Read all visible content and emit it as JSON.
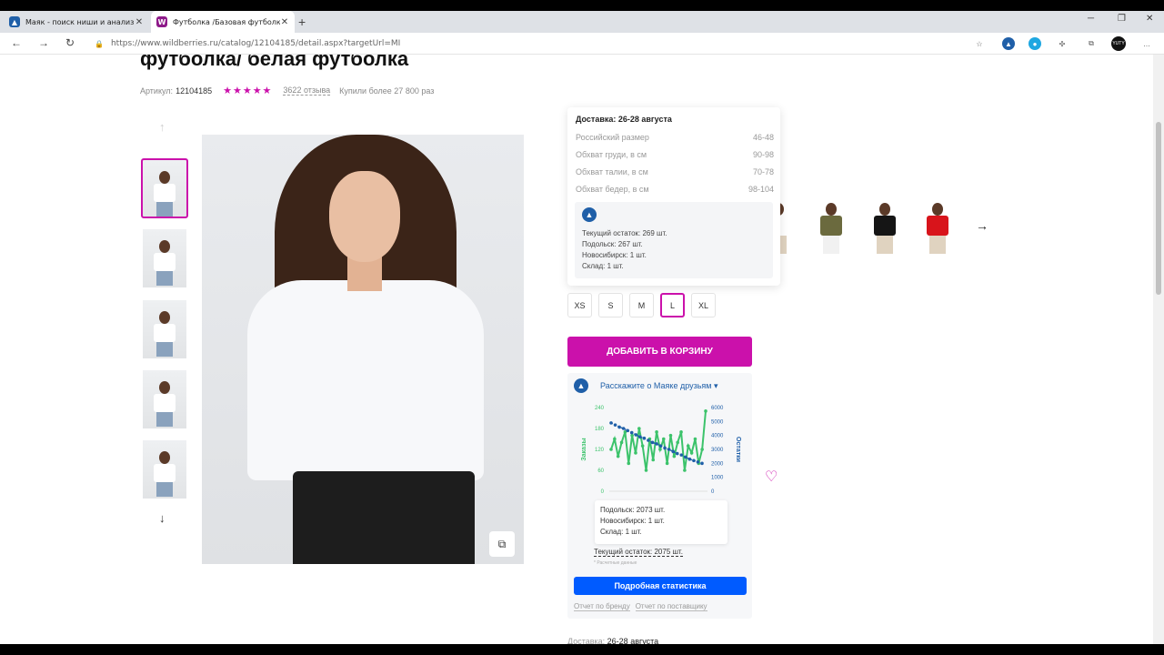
{
  "browser": {
    "tabs": [
      {
        "title": "Маяк - поиск ниши и анализ ко",
        "active": false
      },
      {
        "title": "Футболка /Базовая футболка/ ж",
        "active": true
      }
    ],
    "url": "https://www.wildberries.ru/catalog/12104185/detail.aspx?targetUrl=MI",
    "profile_badge": "YUTY"
  },
  "product": {
    "title": "футболка/ белая футболка",
    "article_label": "Артикул:",
    "article_value": "12104185",
    "stars": "★★★★★",
    "reviews": "3622 отзыва",
    "bought": "Купили более 27 800 раз"
  },
  "size_popup": {
    "delivery": "Доставка: 26-28 августа",
    "rows": [
      {
        "label": "Российский размер",
        "value": "46-48"
      },
      {
        "label": "Обхват груди, в см",
        "value": "90-98"
      },
      {
        "label": "Обхват талии, в см",
        "value": "70-78"
      },
      {
        "label": "Обхват бедер, в см",
        "value": "98-104"
      }
    ],
    "stock_lines": [
      "Текущий остаток: 269 шт.",
      "Подольск: 267 шт.",
      "Новосибирск: 1 шт.",
      "Склад: 1 шт."
    ]
  },
  "sizes": [
    "XS",
    "S",
    "M",
    "L",
    "XL"
  ],
  "selected_size": "L",
  "cart_button": "ДОБАВИТЬ В КОРЗИНУ",
  "widget": {
    "share": "Расскажите о Маяке друзьям",
    "tip_lines": [
      "Подольск: 2073 шт.",
      "Новосибирск: 1 шт.",
      "Склад: 1 шт."
    ],
    "current_stock": "Текущий остаток: 2075 шт.",
    "note": "* Расчетные данные",
    "stats_button": "Подробная статистика",
    "link_brand": "Отчет по бренду",
    "link_supplier": "Отчет по поставщику"
  },
  "chart_data": {
    "type": "line",
    "title": "",
    "ylabel": "Заказы",
    "y2label": "Остатки",
    "yticks": [
      "240",
      "180",
      "120",
      "60",
      "0"
    ],
    "y2ticks": [
      "6000",
      "5000",
      "4000",
      "3000",
      "2000",
      "1000",
      "0"
    ],
    "ylim": [
      0,
      240
    ],
    "y2lim": [
      0,
      6000
    ],
    "series": [
      {
        "name": "Заказы",
        "color": "#3cc36b",
        "axis": "left",
        "values": [
          120,
          150,
          100,
          140,
          170,
          80,
          160,
          110,
          180,
          130,
          60,
          150,
          90,
          170,
          120,
          150,
          80,
          160,
          100,
          140,
          170,
          60,
          130,
          110,
          150,
          80,
          120,
          230
        ]
      },
      {
        "name": "Остатки",
        "color": "#1f5fa8",
        "axis": "right",
        "values": [
          4900,
          4750,
          4600,
          4500,
          4350,
          4200,
          4050,
          3900,
          3800,
          3650,
          3500,
          3400,
          3250,
          3100,
          3000,
          2850,
          2700,
          2600,
          2450,
          2300,
          2200,
          2100,
          2000
        ]
      }
    ]
  },
  "delivery_footer": {
    "label": "Доставка:",
    "value": "26-28 августа"
  },
  "colors": {
    "accent": "#cb11ab",
    "link": "#005bff",
    "brand": "#1f5fa8"
  }
}
